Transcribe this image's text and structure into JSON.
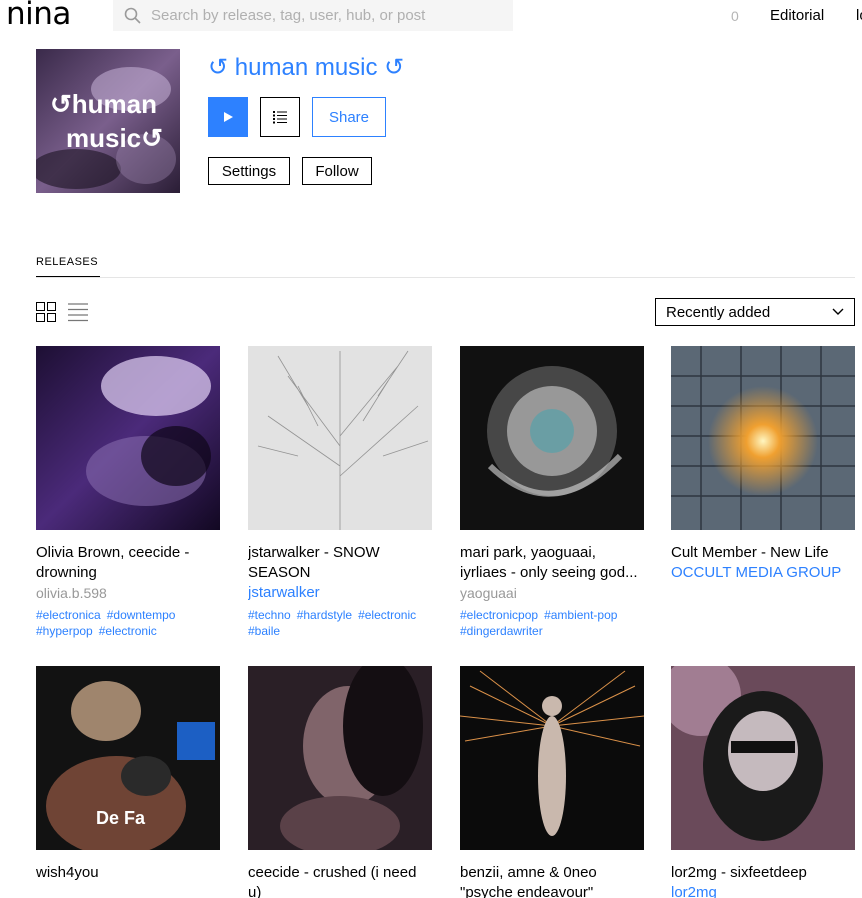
{
  "app": {
    "logo": "nina"
  },
  "search": {
    "placeholder": "Search by release, tag, user, hub, or post"
  },
  "header": {
    "count": "0",
    "nav_editorial": "Editorial",
    "nav_cut": "lo"
  },
  "hub": {
    "title": "↺ human music ↺",
    "art_text_line1": "↺human",
    "art_text_line2": "music↺",
    "share_label": "Share",
    "settings_label": "Settings",
    "follow_label": "Follow"
  },
  "tabs": {
    "releases": "RELEASES"
  },
  "sort": {
    "selected": "Recently added"
  },
  "colors": {
    "accent": "#2D81FF"
  },
  "releases": [
    {
      "title": "Olivia Brown, ceecide - drowning",
      "artist": "olivia.b.598",
      "artist_is_link": false,
      "tags": [
        "#electronica",
        "#downtempo",
        "#hyperpop",
        "#electronic"
      ]
    },
    {
      "title": "jstarwalker - SNOW SEASON",
      "artist": "jstarwalker",
      "artist_is_link": true,
      "tags": [
        "#techno",
        "#hardstyle",
        "#electronic",
        "#baile"
      ]
    },
    {
      "title": "mari park, yaoguaai, iyrliaes - only seeing god...",
      "artist": "yaoguaai",
      "artist_is_link": false,
      "tags": [
        "#electronicpop",
        "#ambient-pop",
        "#dingerdawriter"
      ]
    },
    {
      "title": "Cult Member - New Life",
      "artist": "OCCULT MEDIA GROUP",
      "artist_is_link": true,
      "tags": []
    },
    {
      "title": "wish4you",
      "artist": "",
      "artist_is_link": false,
      "tags": []
    },
    {
      "title": "ceecide - crushed (i need u)",
      "artist": "",
      "artist_is_link": false,
      "tags": []
    },
    {
      "title": "benzii, amne & 0neo \"psyche endeavour\"",
      "artist": "",
      "artist_is_link": false,
      "tags": []
    },
    {
      "title": "lor2mg - sixfeetdeep",
      "artist": "lor2mg",
      "artist_is_link": true,
      "tags": []
    }
  ]
}
